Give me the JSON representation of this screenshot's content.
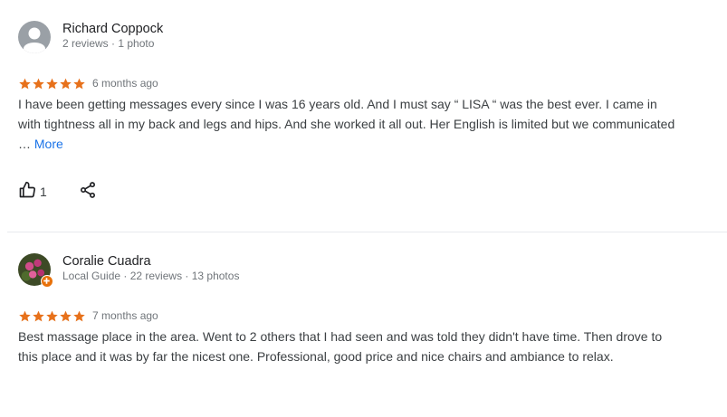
{
  "reviews": [
    {
      "author": "Richard Coppock",
      "meta": "2 reviews · 1 photo",
      "rating": 5,
      "time": "6 months ago",
      "text": "I have been getting messages every since I was 16 years old. And I must say “ LISA “ was the best ever. I came in with tightness all in my back and legs and hips. And she worked it all out. Her English is limited but we communicated …",
      "more_label": "More",
      "like_count": "1"
    },
    {
      "author": "Coralie Cuadra",
      "meta": "Local Guide · 22 reviews · 13 photos",
      "rating": 5,
      "time": "7 months ago",
      "text": "Best massage place in the area. Went to 2 others that I had seen and was told they didn't have time. Then drove to this place and it was by far the nicest one. Professional, good price and nice chairs and ambiance to relax."
    }
  ],
  "colors": {
    "star": "#e7711b",
    "link": "#1a73e8",
    "meta": "#70757a",
    "local_guide_badge": "#e8710a"
  },
  "icons": {
    "like": "thumb-up-icon",
    "share": "share-icon",
    "badge": "local-guide-badge-icon"
  }
}
